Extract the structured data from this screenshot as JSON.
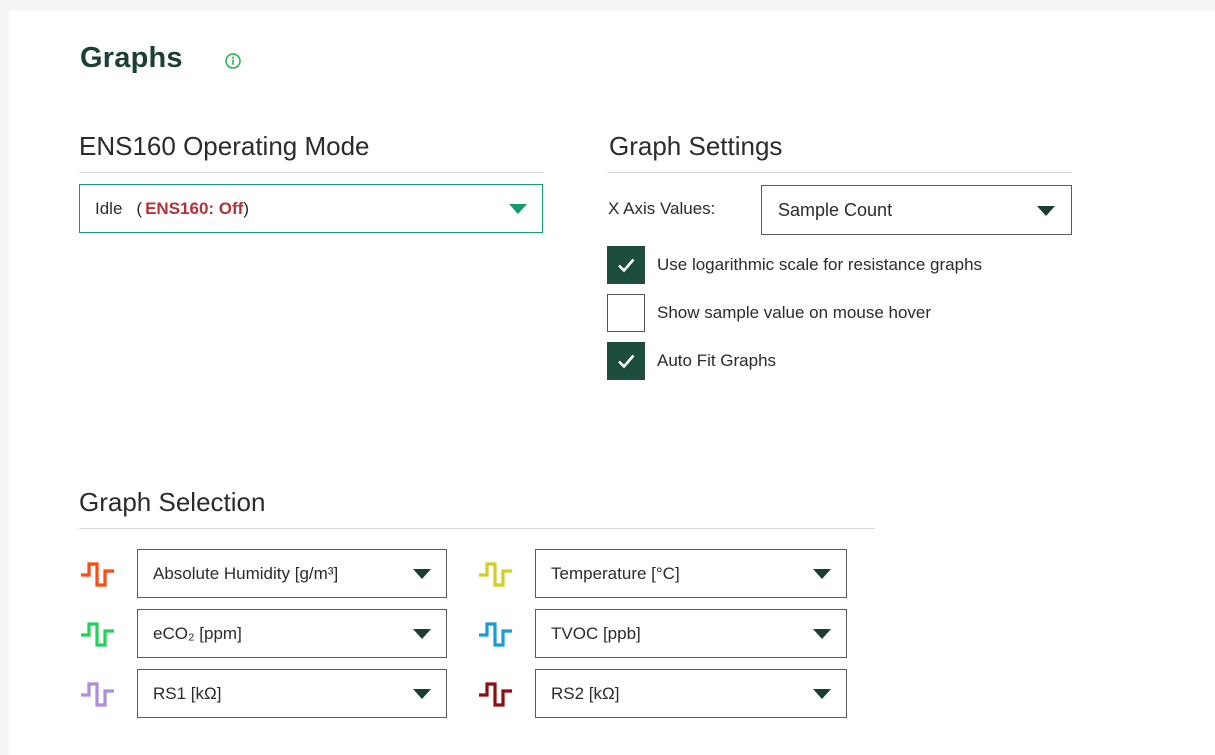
{
  "header": {
    "title": "Graphs"
  },
  "operating_mode": {
    "heading": "ENS160 Operating Mode",
    "value": "Idle",
    "paren_open": "(",
    "status": "ENS160: Off",
    "paren_close": ")"
  },
  "graph_settings": {
    "heading": "Graph Settings",
    "x_axis_label": "X Axis Values:",
    "x_axis_value": "Sample Count",
    "checkboxes": [
      {
        "label": "Use logarithmic scale for resistance graphs",
        "checked": true
      },
      {
        "label": "Show sample value on mouse hover",
        "checked": false
      },
      {
        "label": "Auto Fit Graphs",
        "checked": true
      }
    ]
  },
  "graph_selection": {
    "heading": "Graph Selection",
    "graphs": [
      {
        "label": "Absolute Humidity [g/m³]",
        "color": "#ff4a12"
      },
      {
        "label": "Temperature [°C]",
        "color": "#d2cf22"
      },
      {
        "label": "eCO₂ [ppm]",
        "color": "#22d15a"
      },
      {
        "label": "TVOC [ppb]",
        "color": "#1b9bd8"
      },
      {
        "label": "RS1 [kΩ]",
        "color": "#a98ddf"
      },
      {
        "label": "RS2 [kΩ]",
        "color": "#8b0f12"
      }
    ]
  },
  "colors": {
    "accent": "#149e6f",
    "title": "#1d4034",
    "status_off": "#b2343a",
    "checkbox_checked": "#1d4d3d"
  }
}
